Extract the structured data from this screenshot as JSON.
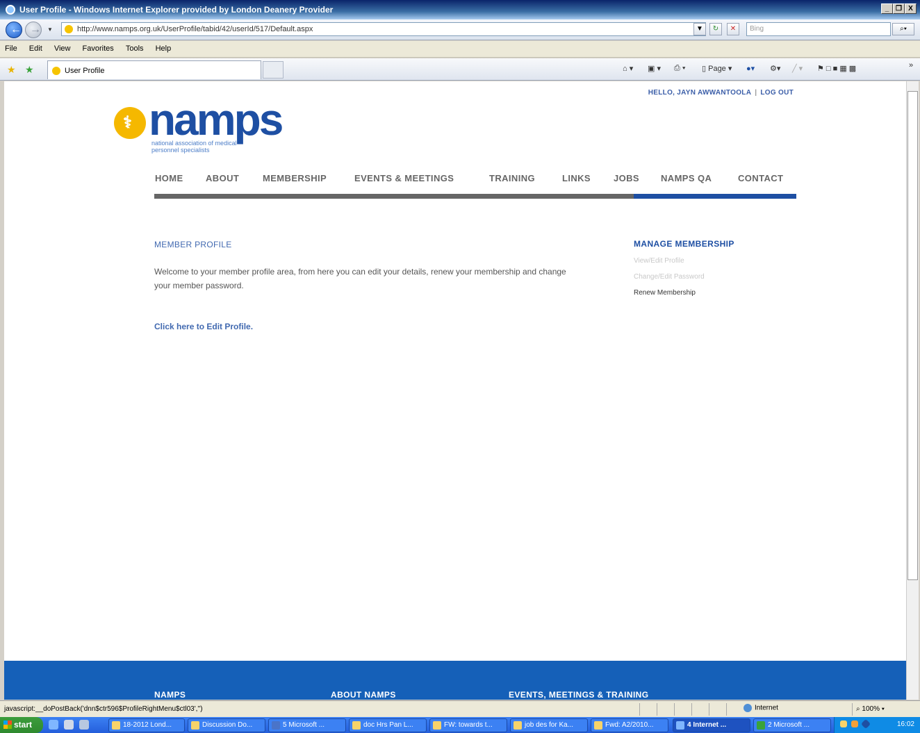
{
  "window": {
    "title": "User Profile - Windows Internet Explorer provided by London Deanery Provider",
    "minimize": "_",
    "restore": "❐",
    "close": "X"
  },
  "address": {
    "url": "http://www.namps.org.uk/UserProfile/tabid/42/userId/517/Default.aspx",
    "search_placeholder": "Bing"
  },
  "menu": [
    "File",
    "Edit",
    "View",
    "Favorites",
    "Tools",
    "Help"
  ],
  "tab": {
    "label": "User Profile"
  },
  "commandbar": {
    "page_label": "Page",
    "more": "»"
  },
  "site": {
    "greeting": "HELLO, JAYN AWWANTOOLA",
    "greeting_sep": "|",
    "logout": "LOG OUT",
    "logo_text": "namps",
    "logo_tagline": "national association of medical personnel specialists",
    "nav": [
      "HOME",
      "ABOUT",
      "MEMBERSHIP",
      "EVENTS & MEETINGS",
      "TRAINING",
      "LINKS",
      "JOBS",
      "NAMPS QA",
      "CONTACT"
    ],
    "member_title": "MEMBER PROFILE",
    "welcome": "Welcome to your member profile area, from here you can edit your details, renew your membership and change your member password.",
    "edit_link": "Click here to Edit Profile.",
    "manage_title": "MANAGE MEMBERSHIP",
    "manage_items": [
      "View/Edit Profile",
      "Change/Edit Password",
      "Renew Membership"
    ],
    "footer": [
      "NAMPS",
      "ABOUT NAMPS",
      "EVENTS, MEETINGS & TRAINING"
    ]
  },
  "status": {
    "text": "javascript:__doPostBack('dnn$ctr596$ProfileRightMenu$ctl03','')",
    "zone": "Internet",
    "zoom": "100%"
  },
  "taskbar": {
    "start": "start",
    "tasks": [
      "18-2012 Lond...",
      "Discussion Do...",
      "5 Microsoft ...",
      "doc Hrs Pan L...",
      "FW: towards t...",
      "job des for Ka...",
      "Fwd: A2/2010...",
      "4 Internet ...",
      "2 Microsoft ..."
    ],
    "clock": "16:02"
  }
}
